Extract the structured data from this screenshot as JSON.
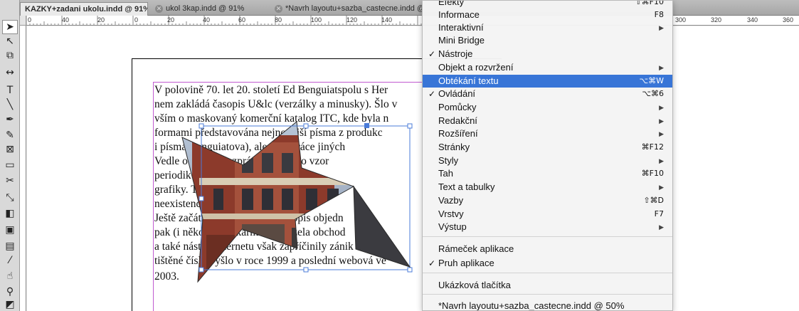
{
  "tabs": [
    {
      "label": "KAZKY+zadani ukolu.indd @ 91%",
      "active": true
    },
    {
      "label": "ukol 3kap.indd @ 91%",
      "active": false
    },
    {
      "label": "*Navrh layoutu+sazba_castecne.indd @ 5",
      "active": false
    }
  ],
  "ruler": {
    "left_ticks": [
      "0",
      "40",
      "20",
      "0",
      "20",
      "40",
      "60",
      "80",
      "100",
      "120",
      "140"
    ],
    "right_ticks": [
      "300",
      "320",
      "340",
      "360"
    ]
  },
  "text_lines": [
    "V polovině 70. let 20. století Ed Benguiatspolu s Her",
    "nem zakládá časopis U&lc (verzálky a minusky). Šlo v",
    "vším o maskovaný komerční katalog ITC, kde byla n",
    "formami představována nejnovější písma z produkc",
    "i písma Benguiatova), ale také práce jiných",
    "Vedle odborných zpráv a hitů typo vzor",
    "periodik časopis U&lc také ilustrac",
    "grafiky. Také pro mnohé fundamental U",
    "neexistence interneto typografic",
    "Ještě začátkem 90. let tento časopis objedn",
    "pak (i několik let) karma docházela obchod",
    "a také nástup internetu však zapříčinily zánik časop",
    "tištěné číslo vyšlo v roce 1999 a poslední webová ve",
    "2003."
  ],
  "menu": {
    "items": [
      {
        "label": "Efekty",
        "shortcut": "⇧⌘F10",
        "checked": false,
        "submenu": false
      },
      {
        "label": "Informace",
        "shortcut": "F8",
        "checked": false,
        "submenu": false
      },
      {
        "label": "Interaktivní",
        "shortcut": "",
        "checked": false,
        "submenu": true
      },
      {
        "label": "Mini Bridge",
        "shortcut": "",
        "checked": false,
        "submenu": false
      },
      {
        "label": "Nástroje",
        "shortcut": "",
        "checked": true,
        "submenu": false
      },
      {
        "label": "Objekt a rozvržení",
        "shortcut": "",
        "checked": false,
        "submenu": true
      },
      {
        "label": "Obtékání textu",
        "shortcut": "⌥⌘W",
        "checked": false,
        "submenu": false,
        "highlighted": true
      },
      {
        "label": "Ovládání",
        "shortcut": "⌥⌘6",
        "checked": true,
        "submenu": false
      },
      {
        "label": "Pomůcky",
        "shortcut": "",
        "checked": false,
        "submenu": true
      },
      {
        "label": "Redakční",
        "shortcut": "",
        "checked": false,
        "submenu": true
      },
      {
        "label": "Rozšíření",
        "shortcut": "",
        "checked": false,
        "submenu": true
      },
      {
        "label": "Stránky",
        "shortcut": "⌘F12",
        "checked": false,
        "submenu": false
      },
      {
        "label": "Styly",
        "shortcut": "",
        "checked": false,
        "submenu": true
      },
      {
        "label": "Tah",
        "shortcut": "⌘F10",
        "checked": false,
        "submenu": false
      },
      {
        "label": "Text a tabulky",
        "shortcut": "",
        "checked": false,
        "submenu": true
      },
      {
        "label": "Vazby",
        "shortcut": "⇧⌘D",
        "checked": false,
        "submenu": false
      },
      {
        "label": "Vrstvy",
        "shortcut": "F7",
        "checked": false,
        "submenu": false
      },
      {
        "label": "Výstup",
        "shortcut": "",
        "checked": false,
        "submenu": true
      },
      {
        "label": "Rámeček aplikace",
        "shortcut": "",
        "checked": false,
        "submenu": false
      },
      {
        "label": "Pruh aplikace",
        "shortcut": "",
        "checked": true,
        "submenu": false
      },
      {
        "label": "Ukázková tlačítka",
        "shortcut": "",
        "checked": false,
        "submenu": false
      },
      {
        "label": "*Navrh layoutu+sazba_castecne.indd @ 50%",
        "shortcut": "",
        "checked": false,
        "submenu": false
      }
    ]
  },
  "tools": [
    {
      "icon": "selection-tool-icon",
      "glyph": "➤"
    },
    {
      "icon": "direct-selection-tool-icon",
      "glyph": "↖"
    },
    {
      "icon": "page-tool-icon",
      "glyph": "⧉"
    },
    {
      "icon": "gap-tool-icon",
      "glyph": "↔"
    },
    {
      "icon": "type-tool-icon",
      "glyph": "T"
    },
    {
      "icon": "line-tool-icon",
      "glyph": "╲"
    },
    {
      "icon": "pen-tool-icon",
      "glyph": "✒"
    },
    {
      "icon": "pencil-tool-icon",
      "glyph": "✎"
    },
    {
      "icon": "rectangle-frame-tool-icon",
      "glyph": "⊠"
    },
    {
      "icon": "rectangle-tool-icon",
      "glyph": "▭"
    },
    {
      "icon": "scissors-tool-icon",
      "glyph": "✂"
    },
    {
      "icon": "free-transform-tool-icon",
      "glyph": "⤡"
    },
    {
      "icon": "gradient-swatch-tool-icon",
      "glyph": "◧"
    },
    {
      "icon": "gradient-feather-tool-icon",
      "glyph": "▣"
    },
    {
      "icon": "note-tool-icon",
      "glyph": "▤"
    },
    {
      "icon": "eyedropper-tool-icon",
      "glyph": "⁄"
    },
    {
      "icon": "hand-tool-icon",
      "glyph": "☝"
    },
    {
      "icon": "zoom-tool-icon",
      "glyph": "⚲"
    },
    {
      "icon": "fill-stroke-icon",
      "glyph": "◩"
    }
  ],
  "colors": {
    "highlight": "#3875d7",
    "frame": "#c05ad1",
    "selection": "#4a7bd8"
  }
}
